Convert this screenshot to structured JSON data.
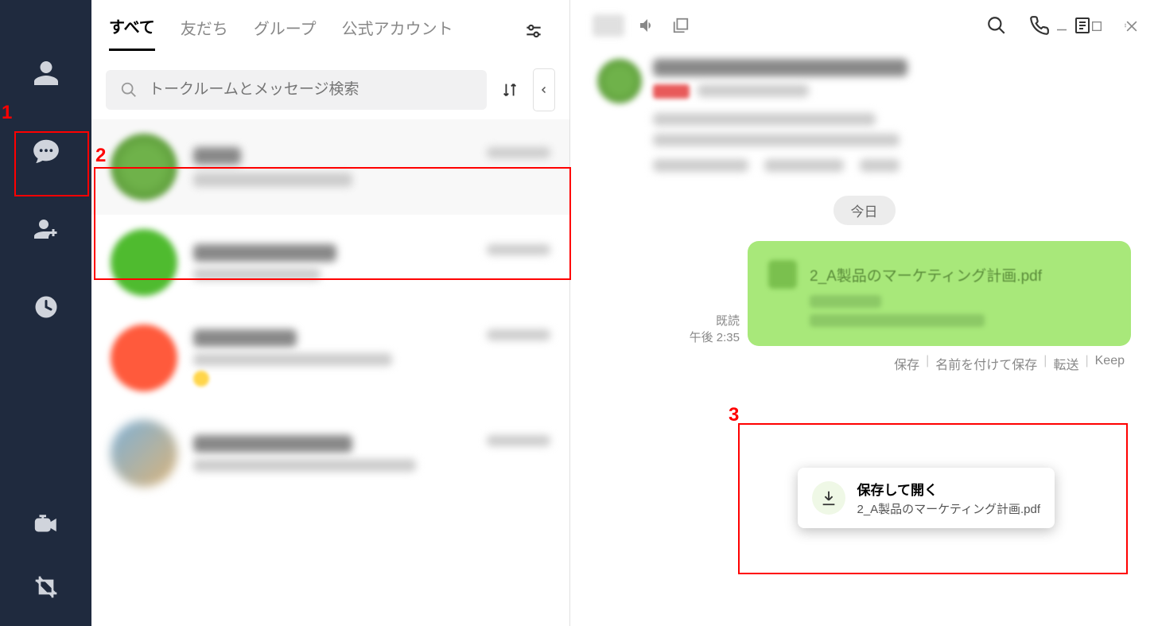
{
  "tabs": {
    "all": "すべて",
    "friends": "友だち",
    "groups": "グループ",
    "official": "公式アカウント"
  },
  "search": {
    "placeholder": "トークルームとメッセージ検索"
  },
  "date_label": "今日",
  "read_label": "既読",
  "time_label": "午後 2:35",
  "file": {
    "name": "2_A製品のマーケティング計画.pdf"
  },
  "file_actions": {
    "save": "保存",
    "save_as": "名前を付けて保存",
    "forward": "転送",
    "keep": "Keep"
  },
  "tooltip": {
    "title": "保存して開く",
    "sub": "2_A製品のマーケティング計画.pdf"
  },
  "annotations": {
    "n1": "1",
    "n2": "2",
    "n3": "3"
  }
}
